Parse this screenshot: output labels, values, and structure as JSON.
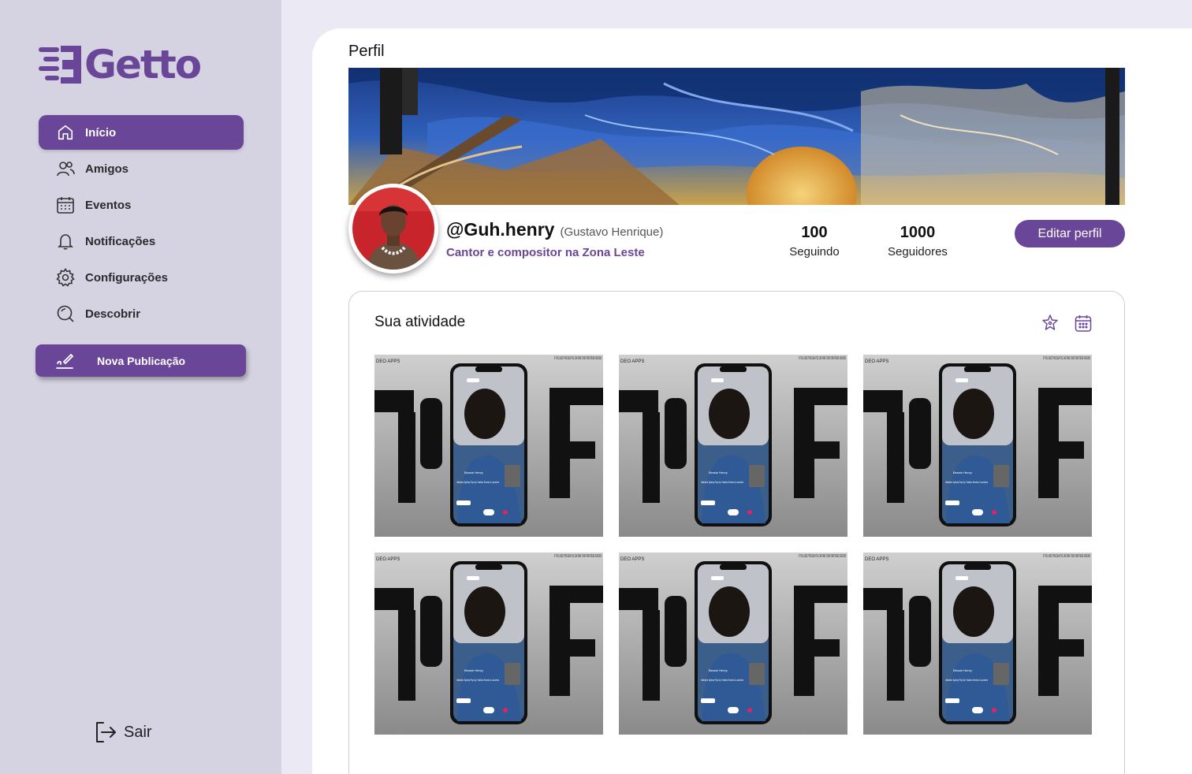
{
  "app": {
    "name": "Getto",
    "brand_color": "#6a4698"
  },
  "sidebar": {
    "items": [
      {
        "label": "Início",
        "icon": "home-icon",
        "active": true
      },
      {
        "label": "Amigos",
        "icon": "users-icon"
      },
      {
        "label": "Eventos",
        "icon": "calendar-icon"
      },
      {
        "label": "Notificações",
        "icon": "bell-icon"
      },
      {
        "label": "Configurações",
        "icon": "gear-icon"
      },
      {
        "label": "Descobrir",
        "icon": "search-icon"
      }
    ],
    "new_post_label": "Nova Publicação",
    "logout_label": "Sair"
  },
  "profile": {
    "page_title": "Perfil",
    "handle": "@Guh.henry",
    "full_name": "(Gustavo Henrique)",
    "bio": "Cantor e compositor na Zona Leste",
    "following_count": "100",
    "following_label": "Seguindo",
    "followers_count": "1000",
    "followers_label": "Seguidores",
    "edit_button": "Editar perfil"
  },
  "activity": {
    "title": "Sua atividade",
    "icons": [
      "star-badge-icon",
      "calendar-icon"
    ],
    "posts": [
      {
        "top_left": "DEO APPS",
        "top_right": "IF YOU LIKED THIS IDEA YOU CAN TAKE YOUR OWN TREND VERSION",
        "app_name": "Bessie Henry",
        "caption": "Valentino Sydney Pop Up: Fashion Events & Launches"
      },
      {
        "top_left": "DEO APPS",
        "top_right": "IF YOU LIKED THIS IDEA YOU CAN TAKE YOUR OWN TREND VERSION",
        "app_name": "Bessie Henry",
        "caption": "Valentino Sydney Pop Up: Fashion Events & Launches"
      },
      {
        "top_left": "DEO APPS",
        "top_right": "IF YOU LIKED THIS IDEA YOU CAN TAKE YOUR OWN TREND VERSION",
        "app_name": "Bessie Henry",
        "caption": "Valentino Sydney Pop Up: Fashion Events & Launches"
      },
      {
        "top_left": "DEO APPS",
        "top_right": "IF YOU LIKED THIS IDEA YOU CAN TAKE YOUR OWN TREND VERSION",
        "app_name": "Bessie Henry",
        "caption": "Valentino Sydney Pop Up: Fashion Events & Launches"
      },
      {
        "top_left": "DEO APPS",
        "top_right": "IF YOU LIKED THIS IDEA YOU CAN TAKE YOUR OWN TREND VERSION",
        "app_name": "Bessie Henry",
        "caption": "Valentino Sydney Pop Up: Fashion Events & Launches"
      },
      {
        "top_left": "DEO APPS",
        "top_right": "IF YOU LIKED THIS IDEA YOU CAN TAKE YOUR OWN TREND VERSION",
        "app_name": "Bessie Henry",
        "caption": "Valentino Sydney Pop Up: Fashion Events & Launches"
      }
    ]
  }
}
